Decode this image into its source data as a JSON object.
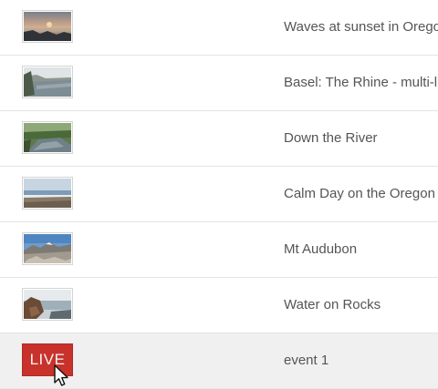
{
  "videos": [
    {
      "title": "Waves at sunset in Oregon",
      "thumb": "sunset-ocean-thumbnail"
    },
    {
      "title": "Basel: The Rhine - multi-li",
      "thumb": "river-city-thumbnail"
    },
    {
      "title": "Down the River",
      "thumb": "forest-river-thumbnail"
    },
    {
      "title": "Calm Day on the Oregon C",
      "thumb": "calm-coast-thumbnail"
    },
    {
      "title": "Mt Audubon",
      "thumb": "mountain-thumbnail"
    },
    {
      "title": "Water on Rocks",
      "thumb": "rocks-water-thumbnail"
    },
    {
      "title": "event 1",
      "thumb": "live-badge",
      "badge": "LIVE"
    }
  ],
  "colors": {
    "live_badge": "#c8322b",
    "title_text": "#555555",
    "divider": "#e3e3e3",
    "hover_row": "#f0f0f0"
  },
  "cursor": "pointer-arrow-cursor-icon"
}
